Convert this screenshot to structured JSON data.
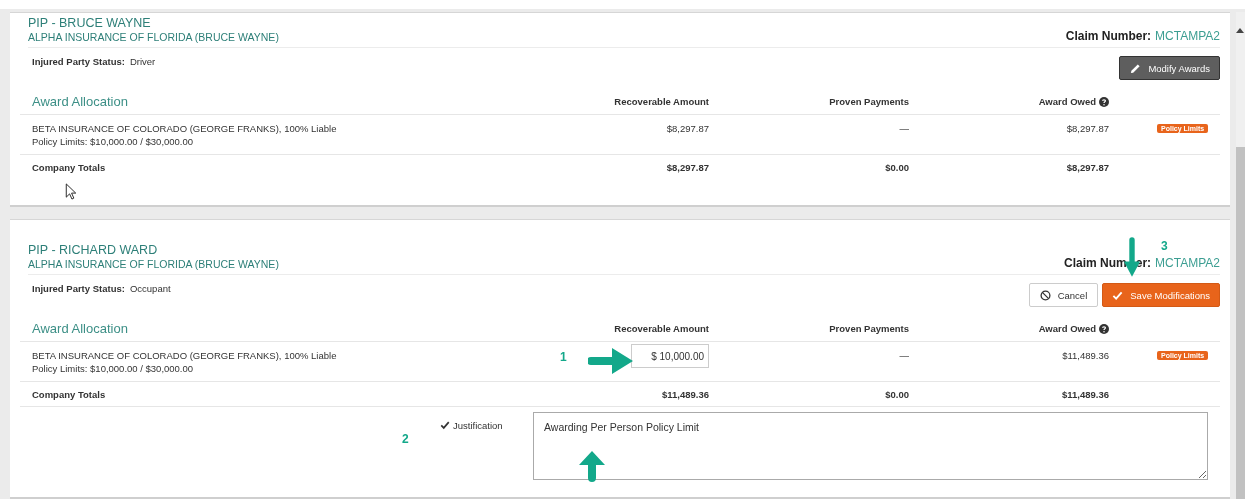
{
  "cards": [
    {
      "title": "PIP - BRUCE WAYNE",
      "subtitle": "ALPHA INSURANCE OF FLORIDA (BRUCE WAYNE)",
      "claim_label": [
        "Claim Number:"
      ],
      "claim_number": "MCTAMPA2",
      "status_label": "Injured Party Status:",
      "status_value": "Driver",
      "buttons": [
        {
          "kind": "modify",
          "label": "Modify Awards"
        }
      ],
      "table": {
        "title": "Award Allocation",
        "columns": [
          "Recoverable Amount",
          "Proven Payments",
          "Award Owed"
        ],
        "rows": [
          {
            "company": "BETA INSURANCE OF COLORADO (GEORGE FRANKS), 100% Liable",
            "limits": "Policy Limits: $10,000.00 / $30,000.00",
            "recoverable": {
              "kind": "text",
              "value": "$8,297.87"
            },
            "proven": "—",
            "owed": "$8,297.87",
            "badge": "Policy Limits"
          }
        ],
        "totals": {
          "label": "Company Totals",
          "recoverable": "$8,297.87",
          "proven": "$0.00",
          "owed": "$8,297.87"
        }
      }
    },
    {
      "title": "PIP - RICHARD WARD",
      "subtitle": "ALPHA INSURANCE OF FLORIDA (BRUCE WAYNE)",
      "claim_label": [
        "Claim Num",
        "er:"
      ],
      "claim_number": "MCTAMPA2",
      "status_label": "Injured Party Status:",
      "status_value": "Occupant",
      "buttons": [
        {
          "kind": "cancel",
          "label": "Cancel"
        },
        {
          "kind": "save",
          "label": "Save Modifications"
        }
      ],
      "table": {
        "title": "Award Allocation",
        "columns": [
          "Recoverable Amount",
          "Proven Payments",
          "Award Owed"
        ],
        "rows": [
          {
            "company": "BETA INSURANCE OF COLORADO (GEORGE FRANKS), 100% Liable",
            "limits": "Policy Limits: $10,000.00 / $30,000.00",
            "recoverable": {
              "kind": "field",
              "value": "$ 10,000.00"
            },
            "proven": "—",
            "owed": "$11,489.36",
            "badge": "Policy Limits"
          }
        ],
        "totals": {
          "label": "Company Totals",
          "recoverable": "$11,489.36",
          "proven": "$0.00",
          "owed": "$11,489.36"
        }
      },
      "justification": {
        "label": "Justification",
        "checked": true,
        "value": "Awarding Per Person Policy Limit"
      },
      "annotations": [
        {
          "label": "1",
          "kind": "right"
        },
        {
          "label": "2",
          "kind": "up"
        },
        {
          "label": "3",
          "kind": "down"
        }
      ]
    }
  ]
}
